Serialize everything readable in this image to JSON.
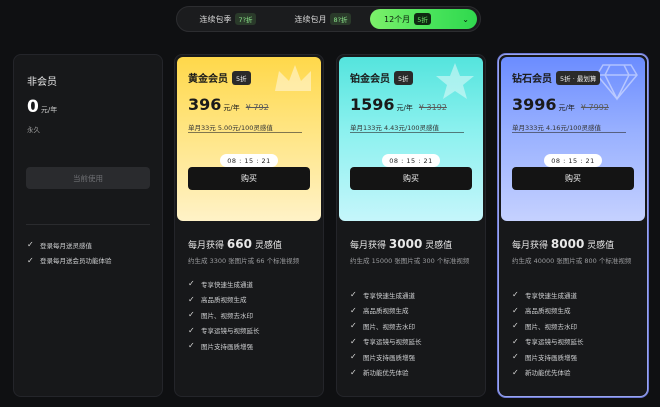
{
  "tabs": [
    {
      "label": "连续包季",
      "discount": "7?折"
    },
    {
      "label": "连续包月",
      "discount": "8?折"
    },
    {
      "label": "12个月",
      "discount": "5折"
    }
  ],
  "free": {
    "name": "非会员",
    "price": "0",
    "unit": "元/年",
    "period": "永久",
    "button": "当前使用",
    "features": [
      "登录每月送灵感值",
      "登录每月送会员功能体验"
    ]
  },
  "plans": [
    {
      "name": "黄金会员",
      "tag": "5折",
      "price": "396",
      "unit": "元/年",
      "original": "¥ 792",
      "monthly": "单月33元 5.00元/100灵感值",
      "timer": "08 : 15 : 21",
      "buy": "购买",
      "quota_prefix": "每月获得",
      "quota": "660",
      "quota_suffix": "灵感值",
      "sub": "约生成 3300 张图片或 66 个标准视频",
      "features": [
        "专享快速生成通道",
        "高品质视频生成",
        "图片、视频去水印",
        "专享运镜与视频延长",
        "图片支持画质增强"
      ]
    },
    {
      "name": "铂金会员",
      "tag": "5折",
      "price": "1596",
      "unit": "元/年",
      "original": "¥ 3192",
      "monthly": "单月133元 4.43元/100灵感值",
      "timer": "08 : 15 : 21",
      "buy": "购买",
      "quota_prefix": "每月获得",
      "quota": "3000",
      "quota_suffix": "灵感值",
      "sub": "约生成 15000 张图片或 300 个标准视频",
      "features": [
        "专享快速生成通道",
        "高品质视频生成",
        "图片、视频去水印",
        "专享运镜与视频延长",
        "图片支持画质增强",
        "新功能优先体验"
      ]
    },
    {
      "name": "钻石会员",
      "tag": "5折 · 最划算",
      "price": "3996",
      "unit": "元/年",
      "original": "¥ 7992",
      "monthly": "单月333元 4.16元/100灵感值",
      "timer": "08 : 15 : 21",
      "buy": "购买",
      "quota_prefix": "每月获得",
      "quota": "8000",
      "quota_suffix": "灵感值",
      "sub": "约生成 40000 张图片或 800 个标准视频",
      "features": [
        "专享快速生成通道",
        "高品质视频生成",
        "图片、视频去水印",
        "专享运镜与视频延长",
        "图片支持画质增强",
        "新功能优先体验"
      ]
    }
  ],
  "icons": {
    "check": "check-icon",
    "chevron": "chevron-down-icon",
    "gold_deco": "crown-icon",
    "plat_deco": "star-icon",
    "dia_deco": "diamond-icon"
  },
  "colors": {
    "accent": "#3fe055",
    "diamond_border": "#9aa6ee"
  }
}
